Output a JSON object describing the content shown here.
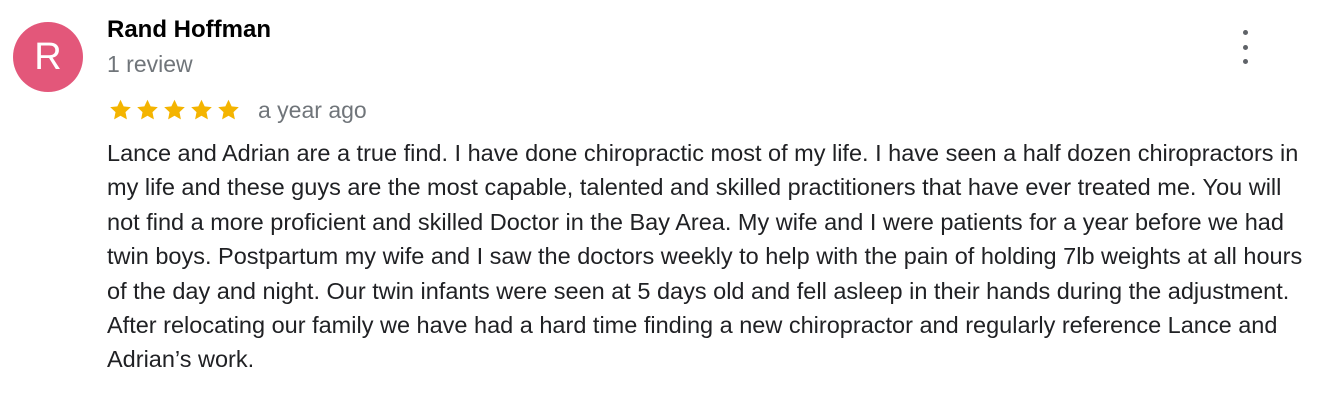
{
  "review": {
    "reviewer": {
      "initial": "R",
      "name": "Rand Hoffman",
      "review_count": "1 review",
      "avatar_color": "#e3577a"
    },
    "rating": 5,
    "max_rating": 5,
    "star_color": "#f4b400",
    "date": "a year ago",
    "text": "Lance and Adrian are a true find. I have done chiropractic most of my life. I have seen a half dozen chiropractors in my life and these guys are the most capable, talented and skilled practitioners that have ever treated me. You will not find a more proficient and skilled Doctor in the Bay Area. My wife and I were patients for a year before we had twin boys. Postpartum my wife and I saw the doctors weekly to help with the pain of holding 7lb weights at all hours of the day and night. Our twin infants were seen at 5 days old and fell asleep in their hands during the adjustment. After relocating our family we have had a hard time finding a new chiropractor and regularly reference Lance and Adrian’s work.",
    "more_icon": "more-vert-icon"
  }
}
